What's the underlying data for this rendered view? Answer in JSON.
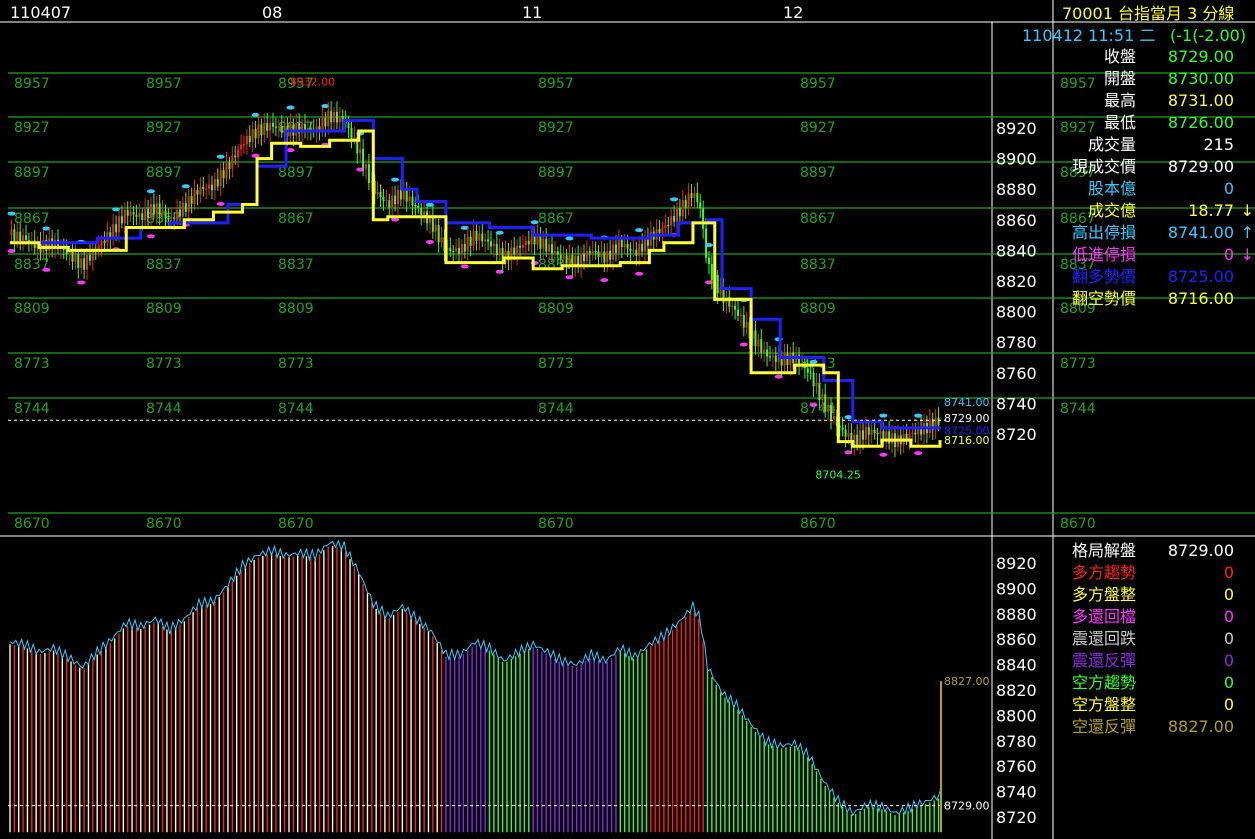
{
  "header": {
    "date_start": "110407",
    "date_labels": [
      "08",
      "11",
      "12"
    ],
    "title": "70001 台指當月 3 分線",
    "timestamp": "110412 11:51 二",
    "change": "(-1(-2.00)"
  },
  "colors": {
    "up": "#ff2020",
    "down": "#33ff33",
    "grid": "#1fa31f",
    "yellow": "#ffff33",
    "blue": "#2020ff",
    "cyan": "#33ccff",
    "magenta": "#ff33ff",
    "purple": "#8a2be2",
    "olive": "#b0a020"
  },
  "quote_panel": [
    {
      "label": "收盤",
      "value": "8729.00",
      "label_color": "#ffffff",
      "value_color": "#33ff33",
      "arrow": ""
    },
    {
      "label": "開盤",
      "value": "8730.00",
      "label_color": "#ffffff",
      "value_color": "#33ff33",
      "arrow": ""
    },
    {
      "label": "最高",
      "value": "8731.00",
      "label_color": "#ffffff",
      "value_color": "#ffff33",
      "arrow": ""
    },
    {
      "label": "最低",
      "value": "8726.00",
      "label_color": "#ffffff",
      "value_color": "#33ff33",
      "arrow": ""
    },
    {
      "label": "成交量",
      "value": "215",
      "label_color": "#ffffff",
      "value_color": "#ffffff",
      "arrow": ""
    },
    {
      "label": "現成交價",
      "value": "8729.00",
      "label_color": "#ffffff",
      "value_color": "#ffffff",
      "arrow": ""
    },
    {
      "label": "股本億",
      "value": "0",
      "label_color": "#33ccff",
      "value_color": "#33ccff",
      "arrow": ""
    },
    {
      "label": "成交億",
      "value": "18.77",
      "label_color": "#ffff33",
      "value_color": "#ffff33",
      "arrow": "↓"
    },
    {
      "label": "高出停損",
      "value": "8741.00",
      "label_color": "#33ccff",
      "value_color": "#33ccff",
      "arrow": "↑"
    },
    {
      "label": "低進停損",
      "value": "0",
      "label_color": "#ff33ff",
      "value_color": "#ff33ff",
      "arrow": "↓"
    },
    {
      "label": "翻多勢價",
      "value": "8725.00",
      "label_color": "#2020ff",
      "value_color": "#2020ff",
      "arrow": ""
    },
    {
      "label": "翻空勢價",
      "value": "8716.00",
      "label_color": "#ffff33",
      "value_color": "#ffff33",
      "arrow": ""
    }
  ],
  "pattern_panel": [
    {
      "label": "格局解盤",
      "value": "8729.00",
      "label_color": "#ffffff",
      "value_color": "#ffffff"
    },
    {
      "label": "多方趨勢",
      "value": "0",
      "label_color": "#ff2020",
      "value_color": "#ff2020"
    },
    {
      "label": "多方盤整",
      "value": "0",
      "label_color": "#ffff33",
      "value_color": "#ffff33"
    },
    {
      "label": "多還回檔",
      "value": "0",
      "label_color": "#ff33ff",
      "value_color": "#ff33ff"
    },
    {
      "label": "震還回跌",
      "value": "0",
      "label_color": "#cccccc",
      "value_color": "#cccccc"
    },
    {
      "label": "震還反彈",
      "value": "0",
      "label_color": "#8a2be2",
      "value_color": "#8a2be2"
    },
    {
      "label": "空方趨勢",
      "value": "0",
      "label_color": "#33ff33",
      "value_color": "#33ff33"
    },
    {
      "label": "空方盤整",
      "value": "0",
      "label_color": "#ffff33",
      "value_color": "#ffff33"
    },
    {
      "label": "空還反彈",
      "value": "8827.00",
      "label_color": "#b0a020",
      "value_color": "#b0a020"
    }
  ],
  "chart_data": [
    {
      "type": "candlestick",
      "ylim": [
        8670,
        8957
      ],
      "y_ticks": [
        8720,
        8740,
        8760,
        8780,
        8800,
        8820,
        8840,
        8860,
        8880,
        8900,
        8920
      ],
      "level_lines": [
        8957,
        8927,
        8897,
        8867,
        8837,
        8809,
        8773,
        8744,
        8670
      ],
      "annotations": {
        "high": "8932.00",
        "low": "8704.25",
        "stop_high": "8741.00",
        "last": "8729.00",
        "long_flip": "8725.00",
        "short_flip": "8716.00"
      },
      "close_path": [
        [
          0,
          8850
        ],
        [
          10,
          8848
        ],
        [
          20,
          8842
        ],
        [
          30,
          8845
        ],
        [
          40,
          8838
        ],
        [
          50,
          8830
        ],
        [
          60,
          8842
        ],
        [
          70,
          8852
        ],
        [
          80,
          8865
        ],
        [
          90,
          8862
        ],
        [
          100,
          8868
        ],
        [
          110,
          8860
        ],
        [
          120,
          8868
        ],
        [
          130,
          8880
        ],
        [
          140,
          8882
        ],
        [
          150,
          8895
        ],
        [
          160,
          8910
        ],
        [
          170,
          8918
        ],
        [
          180,
          8922
        ],
        [
          190,
          8918
        ],
        [
          200,
          8920
        ],
        [
          210,
          8918
        ],
        [
          220,
          8928
        ],
        [
          230,
          8925
        ],
        [
          240,
          8905
        ],
        [
          250,
          8880
        ],
        [
          260,
          8870
        ],
        [
          270,
          8878
        ],
        [
          280,
          8868
        ],
        [
          290,
          8858
        ],
        [
          300,
          8840
        ],
        [
          310,
          8840
        ],
        [
          320,
          8850
        ],
        [
          330,
          8845
        ],
        [
          340,
          8835
        ],
        [
          350,
          8842
        ],
        [
          360,
          8848
        ],
        [
          370,
          8842
        ],
        [
          380,
          8835
        ],
        [
          390,
          8832
        ],
        [
          400,
          8840
        ],
        [
          410,
          8835
        ],
        [
          420,
          8845
        ],
        [
          430,
          8838
        ],
        [
          440,
          8848
        ],
        [
          450,
          8855
        ],
        [
          460,
          8865
        ],
        [
          470,
          8878
        ],
        [
          475,
          8868
        ],
        [
          480,
          8830
        ],
        [
          490,
          8810
        ],
        [
          500,
          8800
        ],
        [
          510,
          8785
        ],
        [
          520,
          8772
        ],
        [
          530,
          8768
        ],
        [
          540,
          8770
        ],
        [
          550,
          8760
        ],
        [
          560,
          8740
        ],
        [
          570,
          8725
        ],
        [
          580,
          8715
        ],
        [
          590,
          8722
        ],
        [
          600,
          8720
        ],
        [
          610,
          8715
        ],
        [
          620,
          8720
        ],
        [
          630,
          8724
        ],
        [
          640,
          8729
        ]
      ],
      "trend_yellow": [
        [
          0,
          8845
        ],
        [
          20,
          8842
        ],
        [
          40,
          8840
        ],
        [
          70,
          8840
        ],
        [
          80,
          8855
        ],
        [
          100,
          8855
        ],
        [
          120,
          8860
        ],
        [
          140,
          8865
        ],
        [
          160,
          8870
        ],
        [
          170,
          8900
        ],
        [
          180,
          8910
        ],
        [
          200,
          8908
        ],
        [
          220,
          8912
        ],
        [
          240,
          8918
        ],
        [
          250,
          8860
        ],
        [
          260,
          8862
        ],
        [
          290,
          8862
        ],
        [
          300,
          8832
        ],
        [
          340,
          8835
        ],
        [
          360,
          8828
        ],
        [
          380,
          8830
        ],
        [
          420,
          8832
        ],
        [
          440,
          8840
        ],
        [
          450,
          8845
        ],
        [
          470,
          8858
        ],
        [
          480,
          8858
        ],
        [
          485,
          8808
        ],
        [
          500,
          8808
        ],
        [
          510,
          8760
        ],
        [
          540,
          8765
        ],
        [
          560,
          8760
        ],
        [
          570,
          8715
        ],
        [
          580,
          8712
        ],
        [
          600,
          8716
        ],
        [
          620,
          8712
        ],
        [
          640,
          8716
        ]
      ],
      "trend_blue": [
        [
          0,
          8845
        ],
        [
          30,
          8845
        ],
        [
          60,
          8848
        ],
        [
          90,
          8855
        ],
        [
          110,
          8858
        ],
        [
          150,
          8870
        ],
        [
          170,
          8895
        ],
        [
          190,
          8918
        ],
        [
          230,
          8925
        ],
        [
          250,
          8900
        ],
        [
          270,
          8880
        ],
        [
          280,
          8872
        ],
        [
          300,
          8858
        ],
        [
          330,
          8855
        ],
        [
          360,
          8850
        ],
        [
          400,
          8848
        ],
        [
          440,
          8850
        ],
        [
          460,
          8858
        ],
        [
          480,
          8860
        ],
        [
          490,
          8815
        ],
        [
          510,
          8795
        ],
        [
          530,
          8770
        ],
        [
          560,
          8755
        ],
        [
          580,
          8728
        ],
        [
          600,
          8724
        ],
        [
          640,
          8725
        ]
      ]
    },
    {
      "type": "bar",
      "ylim": [
        8710,
        8930
      ],
      "y_ticks": [
        8720,
        8740,
        8760,
        8780,
        8800,
        8820,
        8840,
        8860,
        8880,
        8900,
        8920
      ],
      "annotations": {
        "top": "8827.00",
        "last": "8729.00"
      }
    }
  ]
}
